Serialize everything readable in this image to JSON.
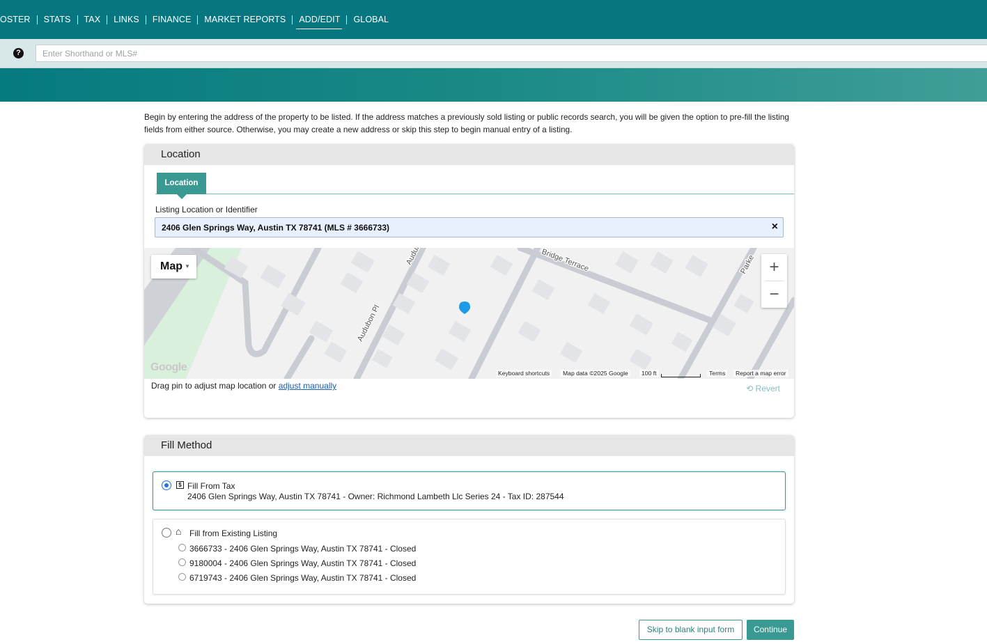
{
  "nav": {
    "items": [
      "OSTER",
      "STATS",
      "TAX",
      "LINKS",
      "FINANCE",
      "MARKET REPORTS",
      "ADD/EDIT",
      "GLOBAL"
    ],
    "active": "ADD/EDIT"
  },
  "search": {
    "placeholder": "Enter Shorthand or MLS#",
    "help_icon": "?"
  },
  "intro_text": "Begin by entering the address of the property to be listed. If the address matches a previously sold listing or public records search, you will be given the option to pre-fill the listing fields from either source. Otherwise, you may create a new address or skip this step to begin manual entry of a listing.",
  "location_panel": {
    "title": "Location",
    "tab_label": "Location",
    "field_label": "Listing Location or Identifier",
    "field_value": "2406 Glen Springs Way, Austin TX 78741 (MLS # 3666733)",
    "clear_icon": "×",
    "map": {
      "type_label": "Map",
      "zoom_in": "+",
      "zoom_out": "−",
      "street_labels": [
        "Audubon Pl",
        "Audubon Pl",
        "Bridge Terrace",
        "Parke"
      ],
      "google_logo": "Google",
      "keyboard_shortcuts": "Keyboard shortcuts",
      "map_data": "Map data ©2025 Google",
      "scale": "100 ft",
      "terms": "Terms",
      "report": "Report a map error"
    },
    "drag_hint": "Drag pin to adjust map location or ",
    "adjust_link": "adjust manually",
    "revert_label": "Revert"
  },
  "fill_panel": {
    "title": "Fill Method",
    "tax_option": {
      "title": "Fill From Tax",
      "icon": "tax-document-icon",
      "detail": "2406 Glen Springs Way, Austin TX 78741 - Owner: Richmond Lambeth Llc Series 24 - Tax ID: 287544",
      "selected": true
    },
    "listing_option": {
      "title": "Fill from Existing Listing",
      "icon": "home-history-icon",
      "selected": false,
      "listings": [
        "3666733 - 2406 Glen Springs Way, Austin TX 78741 - Closed",
        "9180004 - 2406 Glen Springs Way, Austin TX 78741 - Closed",
        "6719743 - 2406 Glen Springs Way, Austin TX 78741 - Closed"
      ]
    }
  },
  "buttons": {
    "skip": "Skip to blank input form",
    "continue": "Continue"
  },
  "colors": {
    "nav_bg": "#067781",
    "accent": "#3a9a93",
    "radio_selected": "#1a73e8",
    "map_pin": "#1e9be8"
  }
}
